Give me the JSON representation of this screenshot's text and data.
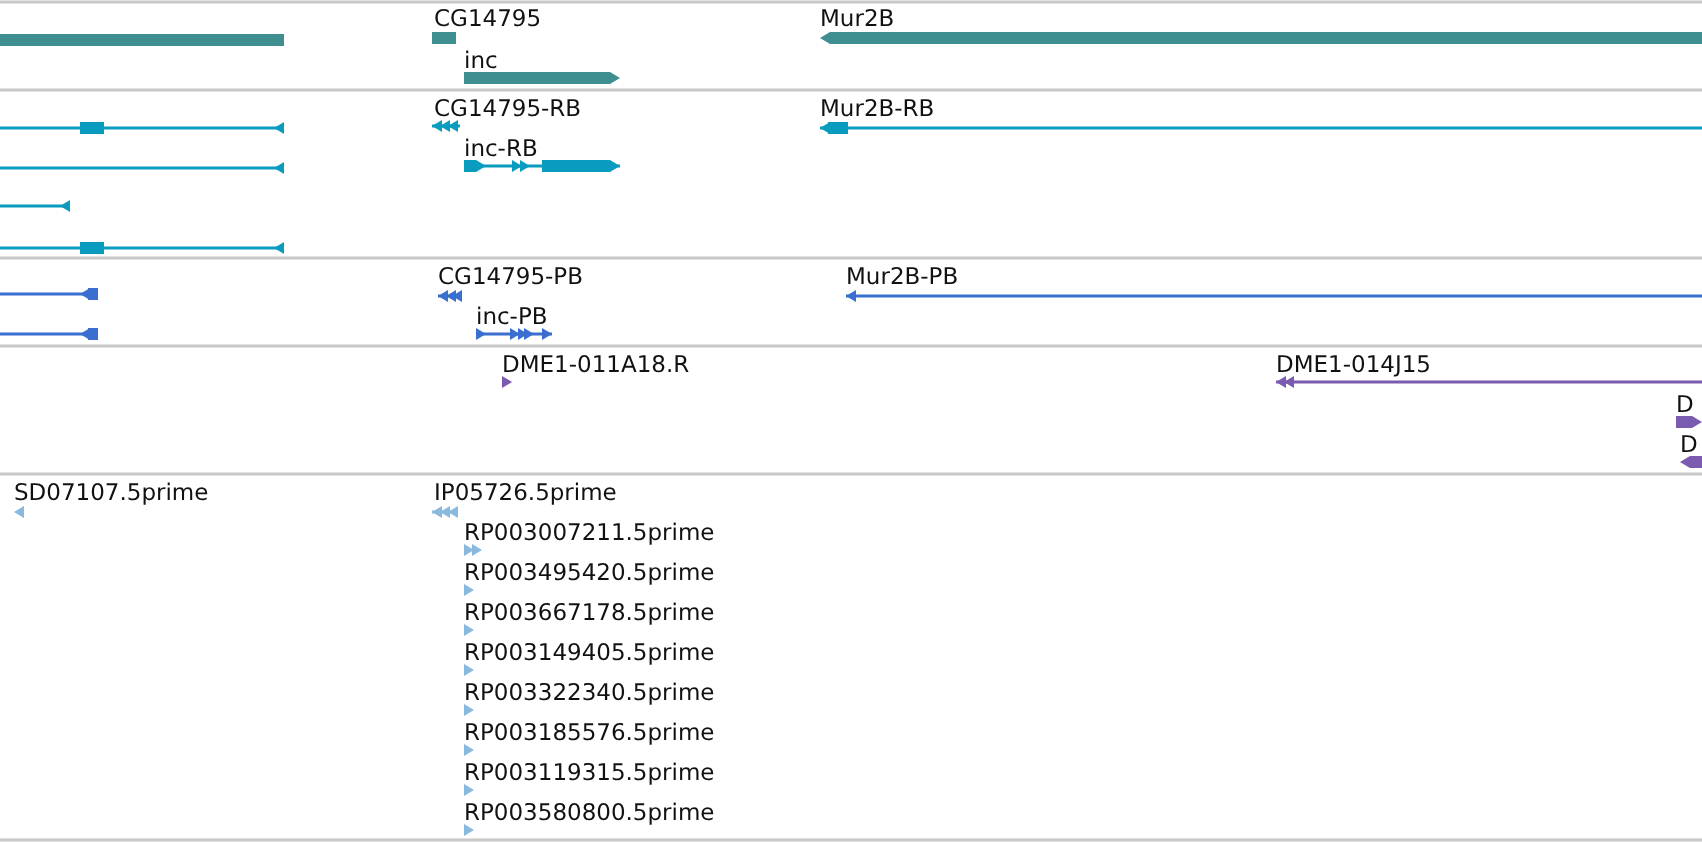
{
  "tracks": [
    {
      "kind": "gene",
      "color": "#3f8f91",
      "features": [
        {
          "label": "CG14795"
        },
        {
          "label": "inc"
        },
        {
          "label": "Mur2B"
        }
      ]
    },
    {
      "kind": "transcript",
      "color": "#0a9cbf",
      "features": [
        {
          "label": "CG14795-RB"
        },
        {
          "label": "inc-RB"
        },
        {
          "label": "Mur2B-RB"
        }
      ]
    },
    {
      "kind": "protein",
      "color": "#3a6fd0",
      "features": [
        {
          "label": "CG14795-PB"
        },
        {
          "label": "inc-PB"
        },
        {
          "label": "Mur2B-PB"
        }
      ]
    },
    {
      "kind": "clone",
      "color": "#7a5bb0",
      "features": [
        {
          "label": "DME1-011A18.R"
        },
        {
          "label": "DME1-014J15"
        },
        {
          "label": "D"
        },
        {
          "label": "D"
        }
      ]
    },
    {
      "kind": "est",
      "color": "#8ab9de",
      "features": [
        {
          "label": "SD07107.5prime"
        },
        {
          "label": "IP05726.5prime"
        },
        {
          "label": "RP003007211.5prime"
        },
        {
          "label": "RP003495420.5prime"
        },
        {
          "label": "RP003667178.5prime"
        },
        {
          "label": "RP003149405.5prime"
        },
        {
          "label": "RP003322340.5prime"
        },
        {
          "label": "RP003185576.5prime"
        },
        {
          "label": "RP003119315.5prime"
        },
        {
          "label": "RP003580800.5prime"
        }
      ]
    }
  ]
}
